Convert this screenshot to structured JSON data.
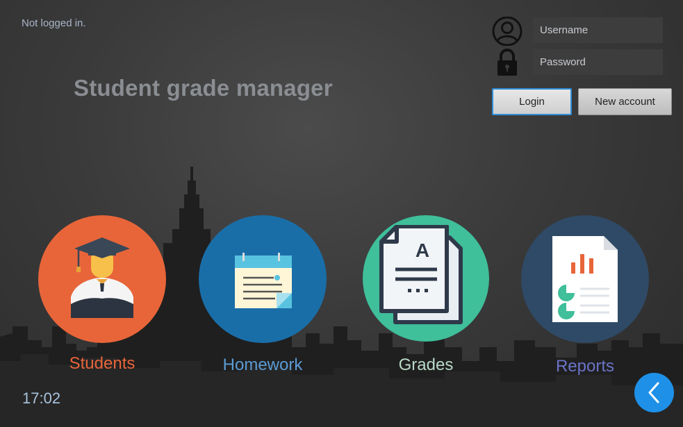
{
  "app": {
    "title": "Student grade manager",
    "status": "Not logged in."
  },
  "login": {
    "username_placeholder": "Username",
    "password_placeholder": "Password",
    "login_label": "Login",
    "new_account_label": "New account"
  },
  "icons": {
    "user": "user-circle-icon",
    "lock": "padlock-icon",
    "back": "chevron-left-icon"
  },
  "tiles": [
    {
      "label": "Students",
      "color": "#e8653a",
      "label_color": "#e8653a",
      "icon": "graduate-icon"
    },
    {
      "label": "Homework",
      "color": "#1a6ea8",
      "label_color": "#5a9bd5",
      "icon": "notepad-icon"
    },
    {
      "label": "Grades",
      "color": "#3fbf9a",
      "label_color": "#b9d9c8",
      "icon": "graded-paper-icon"
    },
    {
      "label": "Reports",
      "color": "#2f4a66",
      "label_color": "#6b74c9",
      "icon": "report-chart-icon"
    }
  ],
  "clock": "17:02",
  "colors": {
    "background": "#3a3a3a",
    "accent": "#1e90e8",
    "title": "#8a8d92"
  }
}
